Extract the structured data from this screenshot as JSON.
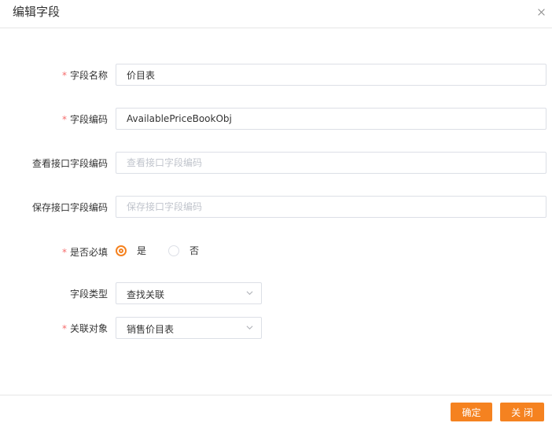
{
  "dialog": {
    "title": "编辑字段",
    "close_icon": "close-icon"
  },
  "form": {
    "required_mark": "*",
    "field_name": {
      "label": "字段名称",
      "value": "价目表",
      "required": true
    },
    "field_code": {
      "label": "字段编码",
      "value": "AvailablePriceBookObj",
      "required": true
    },
    "view_api_code": {
      "label": "查看接口字段编码",
      "value": "",
      "placeholder": "查看接口字段编码",
      "required": false
    },
    "save_api_code": {
      "label": "保存接口字段编码",
      "value": "",
      "placeholder": "保存接口字段编码",
      "required": false
    },
    "is_required": {
      "label": "是否必填",
      "required": true,
      "options": [
        {
          "label": "是",
          "checked": true
        },
        {
          "label": "否",
          "checked": false
        }
      ]
    },
    "field_type": {
      "label": "字段类型",
      "value": "查找关联",
      "icon": "chevron-down-icon"
    },
    "related_object": {
      "label": "关联对象",
      "value": "销售价目表",
      "required": true,
      "icon": "chevron-down-icon"
    }
  },
  "footer": {
    "confirm_label": "确定",
    "close_label": "关 闭"
  },
  "colors": {
    "accent": "#f58220",
    "required": "#f56c6c",
    "border": "#dcdfe6",
    "placeholder": "#c0c4cc"
  }
}
